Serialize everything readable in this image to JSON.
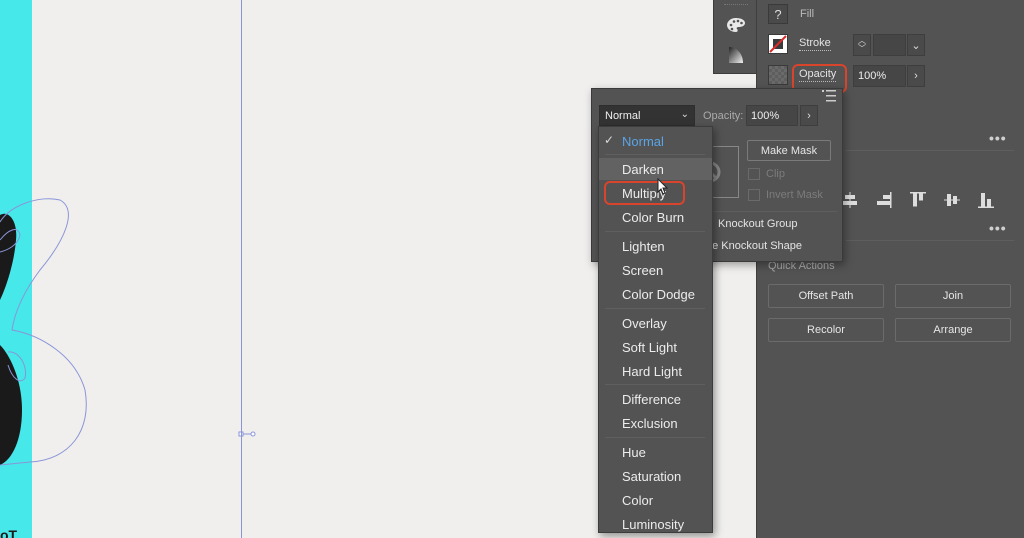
{
  "canvas": {
    "accent_color": "#46e8ea",
    "guide_color": "#8a95d8",
    "partial_text": "oT"
  },
  "mini_tools": {
    "items": [
      {
        "name": "color-palette-icon"
      },
      {
        "name": "gradient-icon"
      }
    ]
  },
  "appearance": {
    "fill_label": "Fill",
    "stroke_label": "Stroke",
    "opacity_label": "Opacity",
    "opacity_value": "100%",
    "fill_icon": "question-mark-icon"
  },
  "transparency": {
    "blend_mode": "Normal",
    "opacity_label": "Opacity:",
    "opacity_value": "100%",
    "make_mask_label": "Make Mask",
    "clip_label": "Clip",
    "invert_mask_label": "Invert Mask",
    "knockout_group_label": "Knockout Group",
    "knockout_shape_label": "ne Knockout Shape"
  },
  "blend_modes": [
    {
      "label": "Normal",
      "selected": true
    },
    {
      "label": "Darken",
      "hover": true
    },
    {
      "label": "Multiply",
      "highlighted": true
    },
    {
      "label": "Color Burn"
    },
    {
      "label": "Lighten"
    },
    {
      "label": "Screen"
    },
    {
      "label": "Color Dodge"
    },
    {
      "label": "Overlay"
    },
    {
      "label": "Soft Light"
    },
    {
      "label": "Hard Light"
    },
    {
      "label": "Difference"
    },
    {
      "label": "Exclusion"
    },
    {
      "label": "Hue"
    },
    {
      "label": "Saturation"
    },
    {
      "label": "Color"
    },
    {
      "label": "Luminosity"
    }
  ],
  "quick_actions": {
    "title": "Quick Actions",
    "buttons": [
      "Offset Path",
      "Join",
      "Recolor",
      "Arrange"
    ]
  },
  "align": {
    "icons": [
      "align-horizontal-center-icon",
      "align-right-icon",
      "align-top-icon",
      "align-vertical-center-icon",
      "align-bottom-icon"
    ]
  },
  "more_label": "•••"
}
